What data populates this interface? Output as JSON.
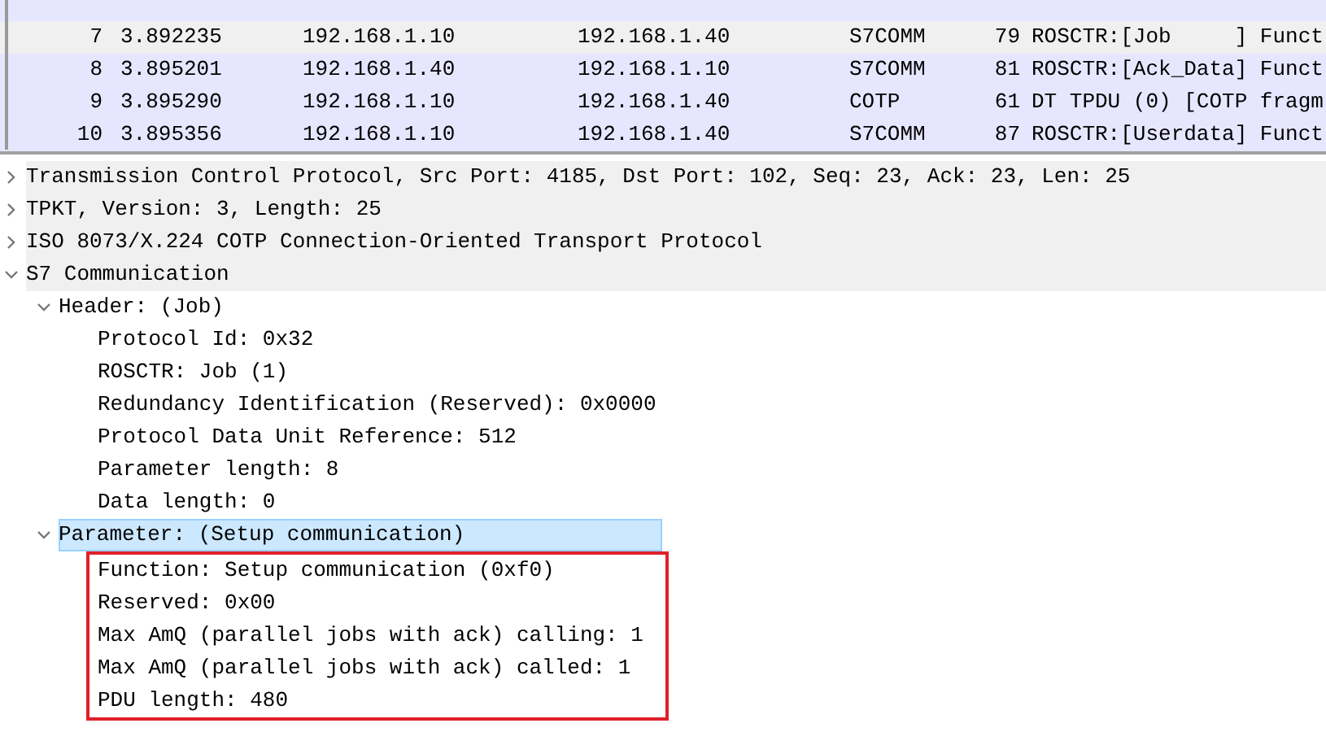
{
  "packets": [
    {
      "no": "7",
      "time": "3.892235",
      "source": "192.168.1.10",
      "destination": "192.168.1.40",
      "protocol": "S7COMM",
      "length": "79",
      "info": "ROSCTR:[Job     ] Funct",
      "selected": true
    },
    {
      "no": "8",
      "time": "3.895201",
      "source": "192.168.1.40",
      "destination": "192.168.1.10",
      "protocol": "S7COMM",
      "length": "81",
      "info": "ROSCTR:[Ack_Data] Funct",
      "selected": false
    },
    {
      "no": "9",
      "time": "3.895290",
      "source": "192.168.1.10",
      "destination": "192.168.1.40",
      "protocol": "COTP",
      "length": "61",
      "info": "DT TPDU (0) [COTP fragm",
      "selected": false
    },
    {
      "no": "10",
      "time": "3.895356",
      "source": "192.168.1.10",
      "destination": "192.168.1.40",
      "protocol": "S7COMM",
      "length": "87",
      "info": "ROSCTR:[Userdata] Funct",
      "selected": false
    }
  ],
  "details": [
    {
      "label": "Transmission Control Protocol, Src Port: 4185, Dst Port: 102, Seq: 23, Ack: 23, Len: 25",
      "expanded": false,
      "selected": false
    },
    {
      "label": "TPKT, Version: 3, Length: 25",
      "expanded": false,
      "selected": false
    },
    {
      "label": "ISO 8073/X.224 COTP Connection-Oriented Transport Protocol",
      "expanded": false,
      "selected": false
    },
    {
      "label": "S7 Communication",
      "expanded": true,
      "selected": false,
      "children": [
        {
          "label": "Header: (Job)",
          "expanded": true,
          "selected": false,
          "children": [
            {
              "label": "Protocol Id: 0x32"
            },
            {
              "label": "ROSCTR: Job (1)"
            },
            {
              "label": "Redundancy Identification (Reserved): 0x0000"
            },
            {
              "label": "Protocol Data Unit Reference: 512"
            },
            {
              "label": "Parameter length: 8"
            },
            {
              "label": "Data length: 0"
            }
          ]
        },
        {
          "label": "Parameter: (Setup communication)",
          "expanded": true,
          "selected": true,
          "children_boxed": true,
          "children": [
            {
              "label": "Function: Setup communication (0xf0)"
            },
            {
              "label": "Reserved: 0x00"
            },
            {
              "label": "Max AmQ (parallel jobs with ack) calling: 1"
            },
            {
              "label": "Max AmQ (parallel jobs with ack) called: 1"
            },
            {
              "label": "PDU length: 480"
            }
          ]
        }
      ]
    }
  ]
}
